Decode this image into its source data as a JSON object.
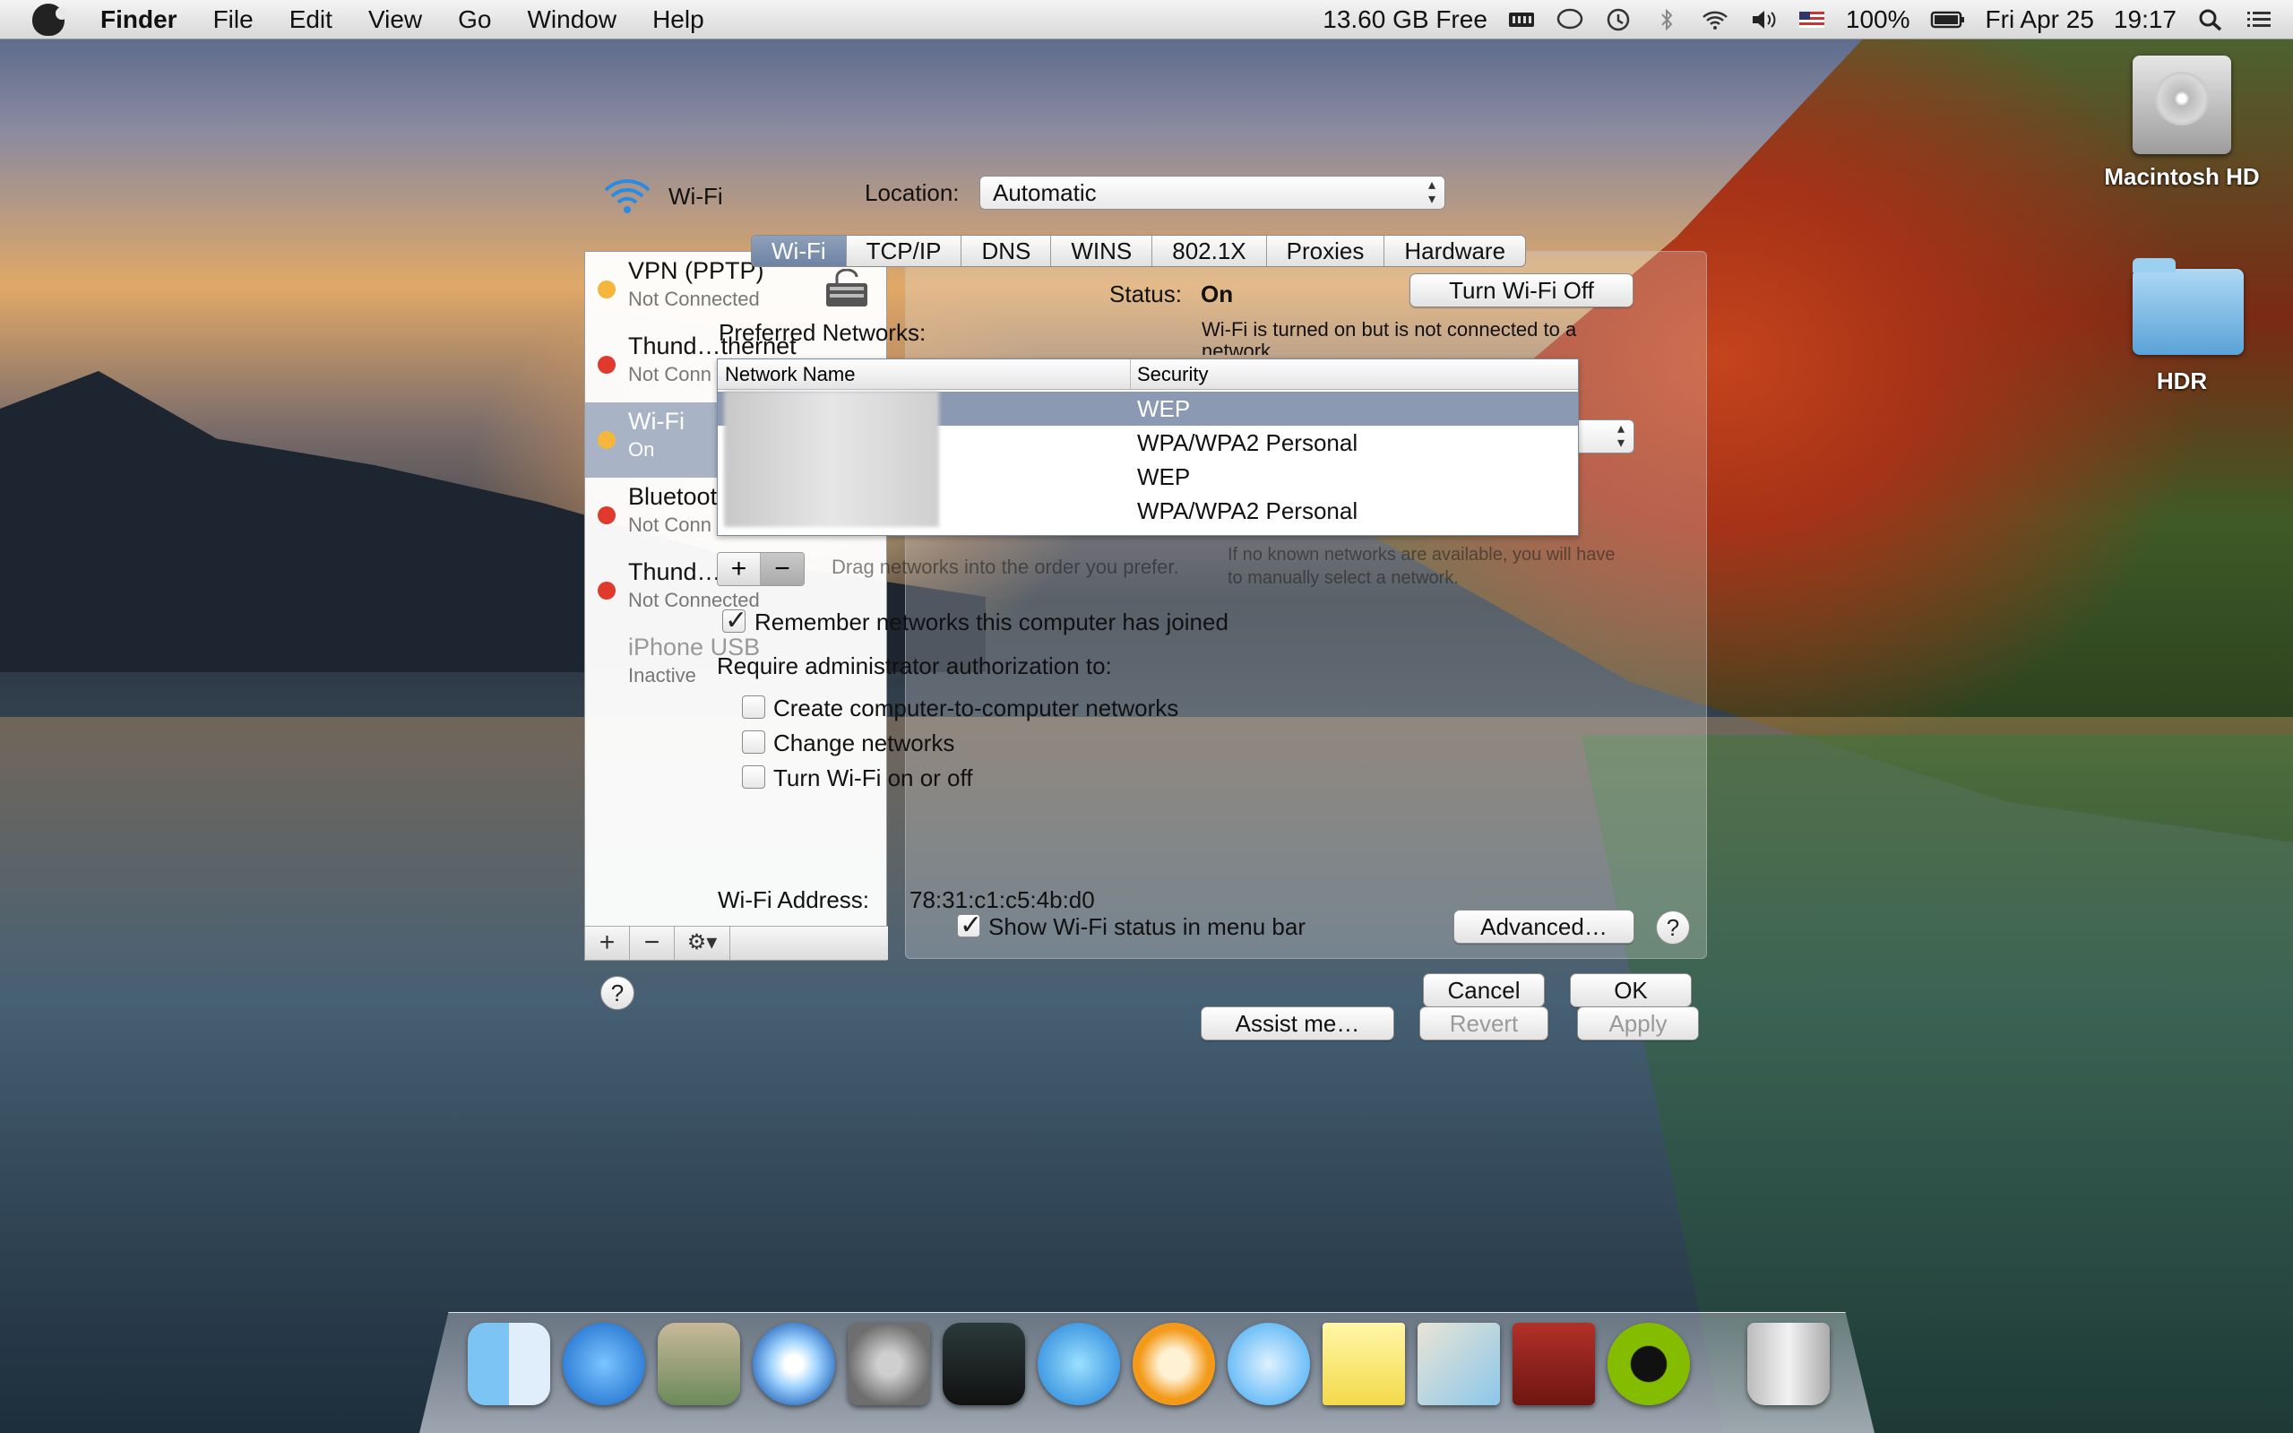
{
  "menubar": {
    "app_name": "Finder",
    "menus": [
      "File",
      "Edit",
      "View",
      "Go",
      "Window",
      "Help"
    ],
    "free_space": "13.60 GB Free",
    "input_source": "US",
    "battery": "100%",
    "date": "Fri Apr 25",
    "time": "19:17"
  },
  "desktop_icons": [
    {
      "label": "Macintosh HD",
      "icon": "hard-drive-icon"
    },
    {
      "label": "HDR",
      "icon": "folder-icon"
    }
  ],
  "network": {
    "header": {
      "service_label": "Wi-Fi",
      "location_label": "Location:",
      "location_value": "Automatic"
    },
    "services": [
      {
        "name": "VPN (PPTP)",
        "state": "Not Connected",
        "status_color": "#f5b63b"
      },
      {
        "name": "Thund…thernet",
        "state": "Not Conn",
        "status_color": "#e03a2d"
      },
      {
        "name": "Wi-Fi",
        "state": "On",
        "status_color": "#f5b63b"
      },
      {
        "name": "Bluetoot",
        "state": "Not Conn",
        "status_color": "#e03a2d"
      },
      {
        "name": "Thund…",
        "state": "Not Connected",
        "status_color": "#e03a2d"
      },
      {
        "name": "iPhone USB",
        "state": "Inactive",
        "status_color": ""
      }
    ],
    "tabs": [
      "Wi-Fi",
      "TCP/IP",
      "DNS",
      "WINS",
      "802.1X",
      "Proxies",
      "Hardware"
    ],
    "active_tab": "Wi-Fi",
    "status_label": "Status:",
    "status_value": "On",
    "status_desc": "Wi-Fi is turned on but is not connected to a network.",
    "turn_off_button": "Turn Wi-Fi Off",
    "preferred_label": "Preferred Networks:",
    "columns": [
      "Network Name",
      "Security"
    ],
    "networks": [
      {
        "security": "WEP"
      },
      {
        "security": "WPA/WPA2 Personal"
      },
      {
        "security": "WEP"
      },
      {
        "security": "WPA/WPA2 Personal"
      }
    ],
    "add_label": "+",
    "remove_label": "−",
    "drag_hint": "Drag networks into the order you prefer.",
    "known_hint": "If no known networks are available, you will have to manually select a network.",
    "remember_label": "Remember networks this computer has joined",
    "require_label": "Require administrator authorization to:",
    "require_options": [
      "Create computer-to-computer networks",
      "Change networks",
      "Turn Wi-Fi on or off"
    ],
    "address_label": "Wi-Fi Address:",
    "address_value": "78:31:c1:c5:4b:d0",
    "show_status_label": "Show Wi-Fi status in menu bar",
    "buttons": {
      "advanced": "Advanced…",
      "help": "?",
      "cancel": "Cancel",
      "ok": "OK",
      "assist": "Assist me…",
      "revert": "Revert",
      "apply": "Apply"
    },
    "sidebar_controls": [
      "+",
      "−",
      "⚙▾"
    ]
  },
  "dock_apps": [
    "Finder",
    "App Store",
    "Preview",
    "Safari",
    "System Preferences",
    "Activity Monitor",
    "iTunes",
    "iBooks",
    "Messages",
    "Stickies",
    "Maps",
    "Dictionary",
    "Spotify",
    "Trash"
  ]
}
